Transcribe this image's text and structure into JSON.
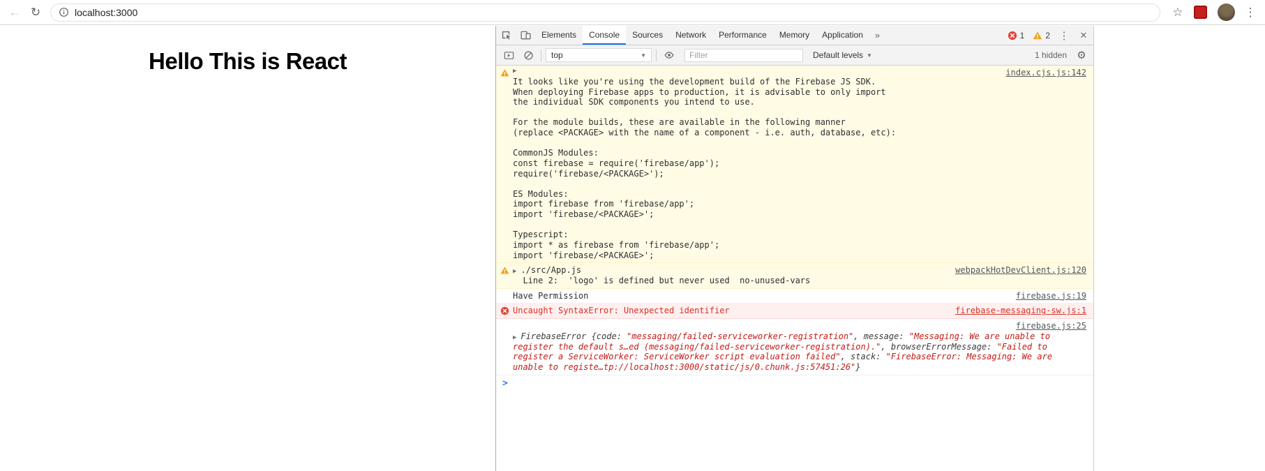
{
  "icons": {
    "back": "←",
    "reload": "↻",
    "star": "☆",
    "kebab": "⋮",
    "close": "✕",
    "more_tabs": "»",
    "caret_down": "▼",
    "gear": "⚙",
    "expander": "▶",
    "prompt": ">"
  },
  "colors": {
    "accent_blue": "#1a73e8",
    "warning_bg": "#fffbe5",
    "warning_border": "#fff5c2",
    "warning_icon": "#f0a21b",
    "error_bg": "#fff0f0",
    "error_border": "#ffd6d6",
    "error_text": "#d93025",
    "error_icon": "#e3443a",
    "string_value": "#c41a16"
  },
  "browser": {
    "url": "localhost:3000"
  },
  "page": {
    "heading": "Hello This is React"
  },
  "devtools": {
    "tabs": [
      {
        "label": "Elements",
        "active": false
      },
      {
        "label": "Console",
        "active": true
      },
      {
        "label": "Sources",
        "active": false
      },
      {
        "label": "Network",
        "active": false
      },
      {
        "label": "Performance",
        "active": false
      },
      {
        "label": "Memory",
        "active": false
      },
      {
        "label": "Application",
        "active": false
      }
    ],
    "error_count": "1",
    "warning_count": "2",
    "console_toolbar": {
      "context_selector": "top",
      "filter_placeholder": "Filter",
      "levels_label": "Default levels",
      "hidden_count": "1 hidden"
    },
    "messages": [
      {
        "type": "warning",
        "expandable": true,
        "expander_own_line": true,
        "source": "index.cjs.js:142",
        "text": "It looks like you're using the development build of the Firebase JS SDK.\nWhen deploying Firebase apps to production, it is advisable to only import\nthe individual SDK components you intend to use.\n\nFor the module builds, these are available in the following manner\n(replace <PACKAGE> with the name of a component - i.e. auth, database, etc):\n\nCommonJS Modules:\nconst firebase = require('firebase/app');\nrequire('firebase/<PACKAGE>');\n\nES Modules:\nimport firebase from 'firebase/app';\nimport 'firebase/<PACKAGE>';\n\nTypescript:\nimport * as firebase from 'firebase/app';\nimport 'firebase/<PACKAGE>';"
      },
      {
        "type": "warning",
        "expandable": true,
        "source": "webpackHotDevClient.js:120",
        "text": "./src/App.js\n  Line 2:  'logo' is defined but never used  no-unused-vars"
      },
      {
        "type": "log",
        "source": "firebase.js:19",
        "text": "Have Permission"
      },
      {
        "type": "error",
        "source": "firebase-messaging-sw.js:1",
        "text": "Uncaught SyntaxError: Unexpected identifier"
      },
      {
        "type": "log-object",
        "expandable": true,
        "source_own_line": true,
        "source": "firebase.js:25",
        "parts": [
          {
            "style": "plain",
            "text": "FirebaseError "
          },
          {
            "style": "plain",
            "text": "{code: "
          },
          {
            "style": "string",
            "text": "\"messaging/failed-serviceworker-registration\""
          },
          {
            "style": "plain",
            "text": ", message: "
          },
          {
            "style": "string",
            "text": "\"Messaging: We are unable to register the default s…ed (messaging/failed-serviceworker-registration).\""
          },
          {
            "style": "plain",
            "text": ", browserErrorMessage: "
          },
          {
            "style": "string",
            "text": "\"Failed to register a ServiceWorker: ServiceWorker script evaluation failed\""
          },
          {
            "style": "plain",
            "text": ", stack: "
          },
          {
            "style": "string",
            "text": "\"FirebaseError: Messaging: We are unable to registe…tp://localhost:3000/static/js/0.chunk.js:57451:26\""
          },
          {
            "style": "plain",
            "text": "}"
          }
        ]
      }
    ]
  }
}
